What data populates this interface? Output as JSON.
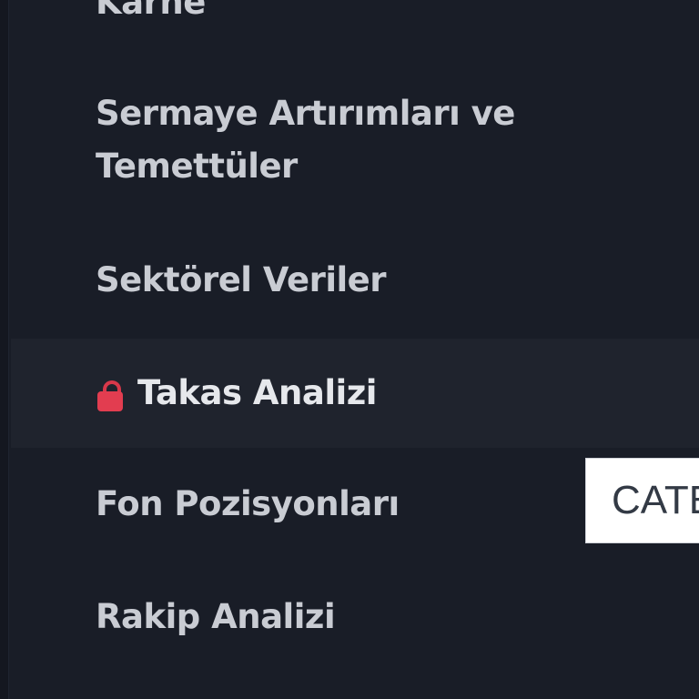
{
  "menu": {
    "items": [
      {
        "label": "Karne"
      },
      {
        "label": "Sermaye Artırımları ve Temettüler"
      },
      {
        "label": "Sektörel Veriler"
      },
      {
        "label": "Takas Analizi",
        "icon": "lock-icon",
        "locked": true
      },
      {
        "label": "Fon Pozisyonları"
      },
      {
        "label": "Rakip Analizi"
      }
    ]
  },
  "category_button": {
    "label": "CATE"
  },
  "colors": {
    "background": "#191d27",
    "highlight": "#1f232d",
    "text": "#c9ccd3",
    "lock": "#e23d50"
  }
}
